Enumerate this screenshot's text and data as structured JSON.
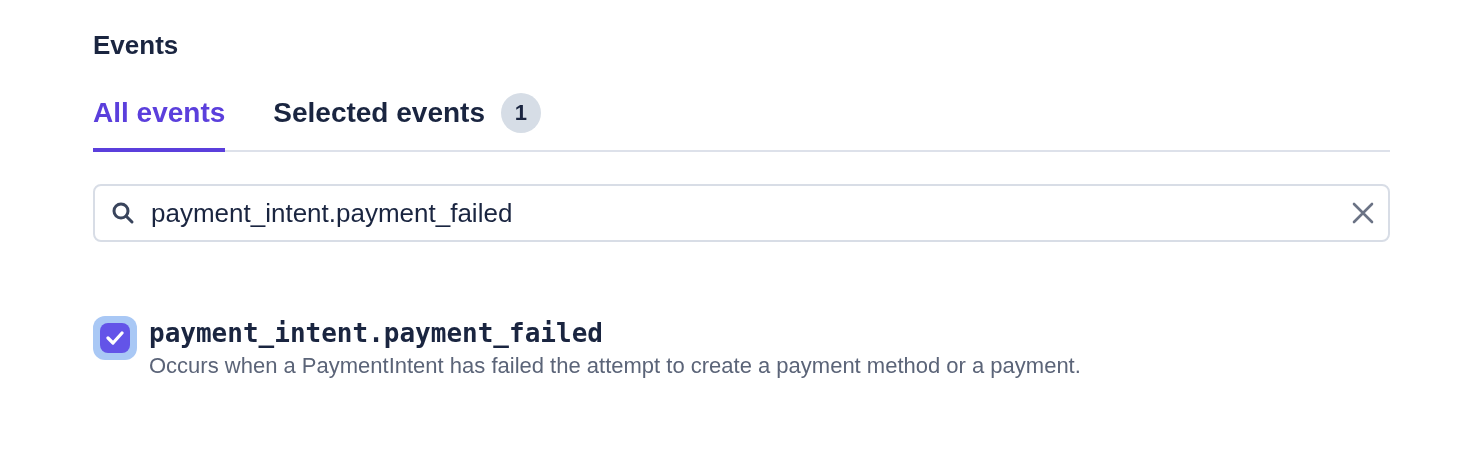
{
  "section": {
    "title": "Events"
  },
  "tabs": [
    {
      "label": "All events",
      "selected": true
    },
    {
      "label": "Selected events",
      "selected": false,
      "count": "1"
    }
  ],
  "search": {
    "value": "payment_intent.payment_failed"
  },
  "events": [
    {
      "name": "payment_intent.payment_failed",
      "checked": true,
      "description": "Occurs when a PaymentIntent has failed the attempt to create a payment method or a payment."
    }
  ]
}
